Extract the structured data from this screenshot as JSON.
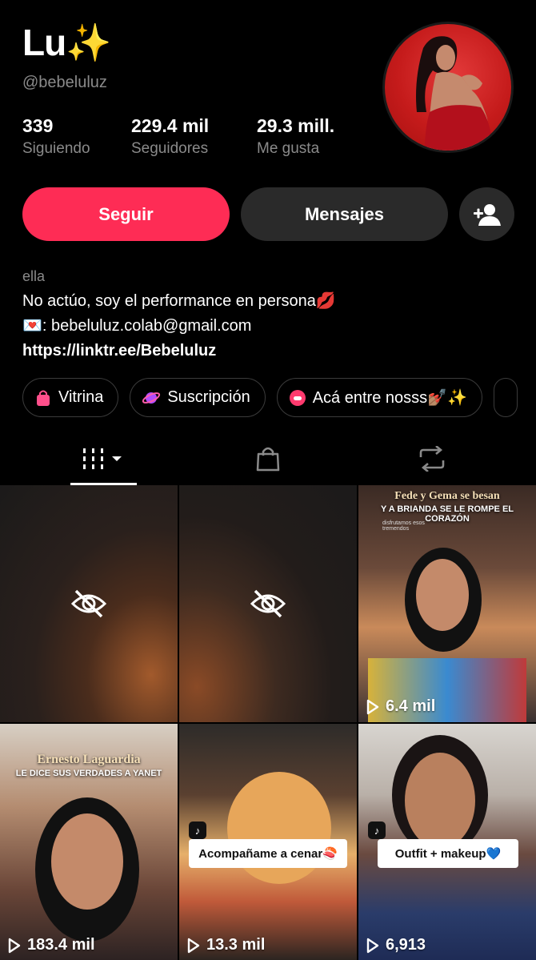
{
  "profile": {
    "name": "Lu✨",
    "handle": "@bebeluluz",
    "stats": [
      {
        "value": "339",
        "label": "Siguiendo"
      },
      {
        "value": "229.4 mil",
        "label": "Seguidores"
      },
      {
        "value": "29.3 mill.",
        "label": "Me gusta"
      }
    ]
  },
  "actions": {
    "follow": "Seguir",
    "message": "Mensajes"
  },
  "bio": {
    "pronouns": "ella",
    "line1": "No actúo, soy el performance en persona💋",
    "line2": "💌: bebeluluz.colab@gmail.com",
    "link": "https://linktr.ee/Bebeluluz"
  },
  "chips": [
    {
      "label": "Vitrina",
      "color": "#ff4f8b"
    },
    {
      "label": "Suscripción",
      "color": "#b14bff"
    },
    {
      "label": "Acá entre nosss💅🏽✨",
      "color": "#ff3a6e"
    }
  ],
  "videos": [
    {
      "views": "",
      "hidden": true
    },
    {
      "views": "",
      "hidden": true
    },
    {
      "views": "6.4 mil",
      "title_top": "Fede y Gema se besan",
      "title_bottom": "Y A BRIANDA SE LE ROMPE EL CORAZÓN",
      "caption": "disfrutamos esos tremendos"
    },
    {
      "views": "183.4 mil",
      "title_top": "Ernesto Laguardia",
      "title_bottom": "LE DICE SUS VERDADES A YANET"
    },
    {
      "views": "13.3 mil",
      "sticker": "Acompañame a cenar🍣"
    },
    {
      "views": "6,913",
      "sticker": "Outfit + makeup💙"
    }
  ],
  "colors": {
    "accent": "#fe2c55",
    "secondary_button": "#2a2a2a",
    "muted_text": "#8a8a8a"
  }
}
